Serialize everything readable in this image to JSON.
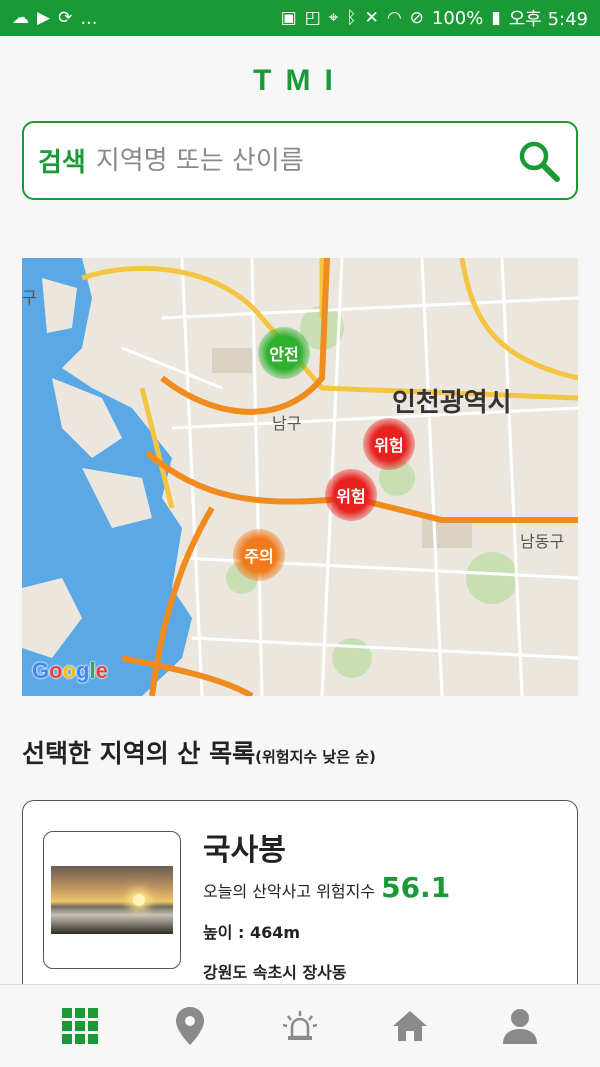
{
  "status_bar": {
    "left_icons": [
      "cloud-icon",
      "video-icon",
      "sync-icon"
    ],
    "left_ellipsis": "...",
    "battery_percent": "100%",
    "time": "오후 5:49"
  },
  "app": {
    "title": "TMI"
  },
  "search": {
    "label": "검색",
    "placeholder": "지역명 또는 산이름"
  },
  "map": {
    "labels": {
      "city": "인천광역시",
      "district1": "남구",
      "district2": "남동구",
      "edge": "구"
    },
    "markers": [
      {
        "label": "안전",
        "level": "safe"
      },
      {
        "label": "위험",
        "level": "danger"
      },
      {
        "label": "위험",
        "level": "danger"
      },
      {
        "label": "주의",
        "level": "caution"
      }
    ],
    "attribution": "Google"
  },
  "list": {
    "title": "선택한 지역의 산 목록",
    "subtitle": "(위험지수 낮은 순)"
  },
  "card": {
    "name": "국사봉",
    "risk_label": "오늘의 산악사고 위험지수",
    "risk_value": "56.1",
    "height": "높이 : 464m",
    "location": "강원도 속초시 장사동"
  },
  "nav": {
    "items": [
      "grid-icon",
      "location-pin-icon",
      "siren-icon",
      "home-icon",
      "profile-icon"
    ],
    "active_color": "#1a9a37",
    "inactive_color": "#8a8a8a"
  },
  "colors": {
    "brand": "#1a9a37",
    "safe": "#2fb12f",
    "danger": "#e8201e",
    "caution": "#f07a1c"
  }
}
